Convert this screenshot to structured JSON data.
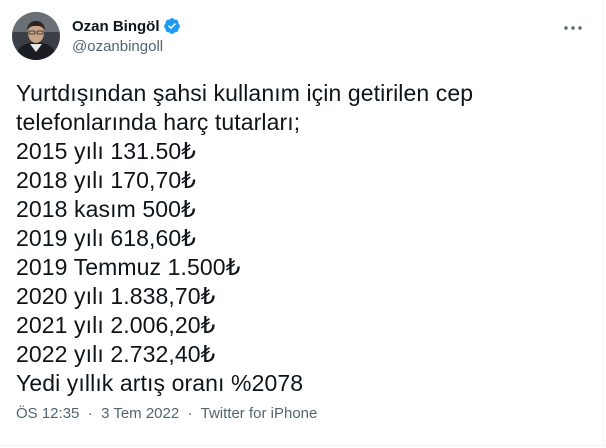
{
  "author": {
    "display_name": "Ozan Bingöl",
    "handle": "@ozanbingoll",
    "verified": true,
    "avatar_icon": "profile-photo"
  },
  "menu_icon": "more-horizontal-icon",
  "tweet": {
    "lines": [
      "Yurtdışından şahsi kullanım için getirilen cep",
      "telefonlarında harç tutarları;",
      "2015 yılı 131.50₺",
      "2018 yılı 170,70₺",
      "2018 kasım 500₺",
      "2019 yılı 618,60₺",
      "2019 Temmuz 1.500₺",
      "2020 yılı 1.838,70₺",
      "2021 yılı 2.006,20₺",
      "2022 yılı 2.732,40₺",
      "Yedi yıllık artış oranı %2078"
    ]
  },
  "meta": {
    "time": "ÖS 12:35",
    "separator": "·",
    "date": "3 Tem 2022",
    "source": "Twitter for iPhone"
  },
  "colors": {
    "text": "#0f1419",
    "secondary": "#536471",
    "verified": "#1d9bf0"
  }
}
